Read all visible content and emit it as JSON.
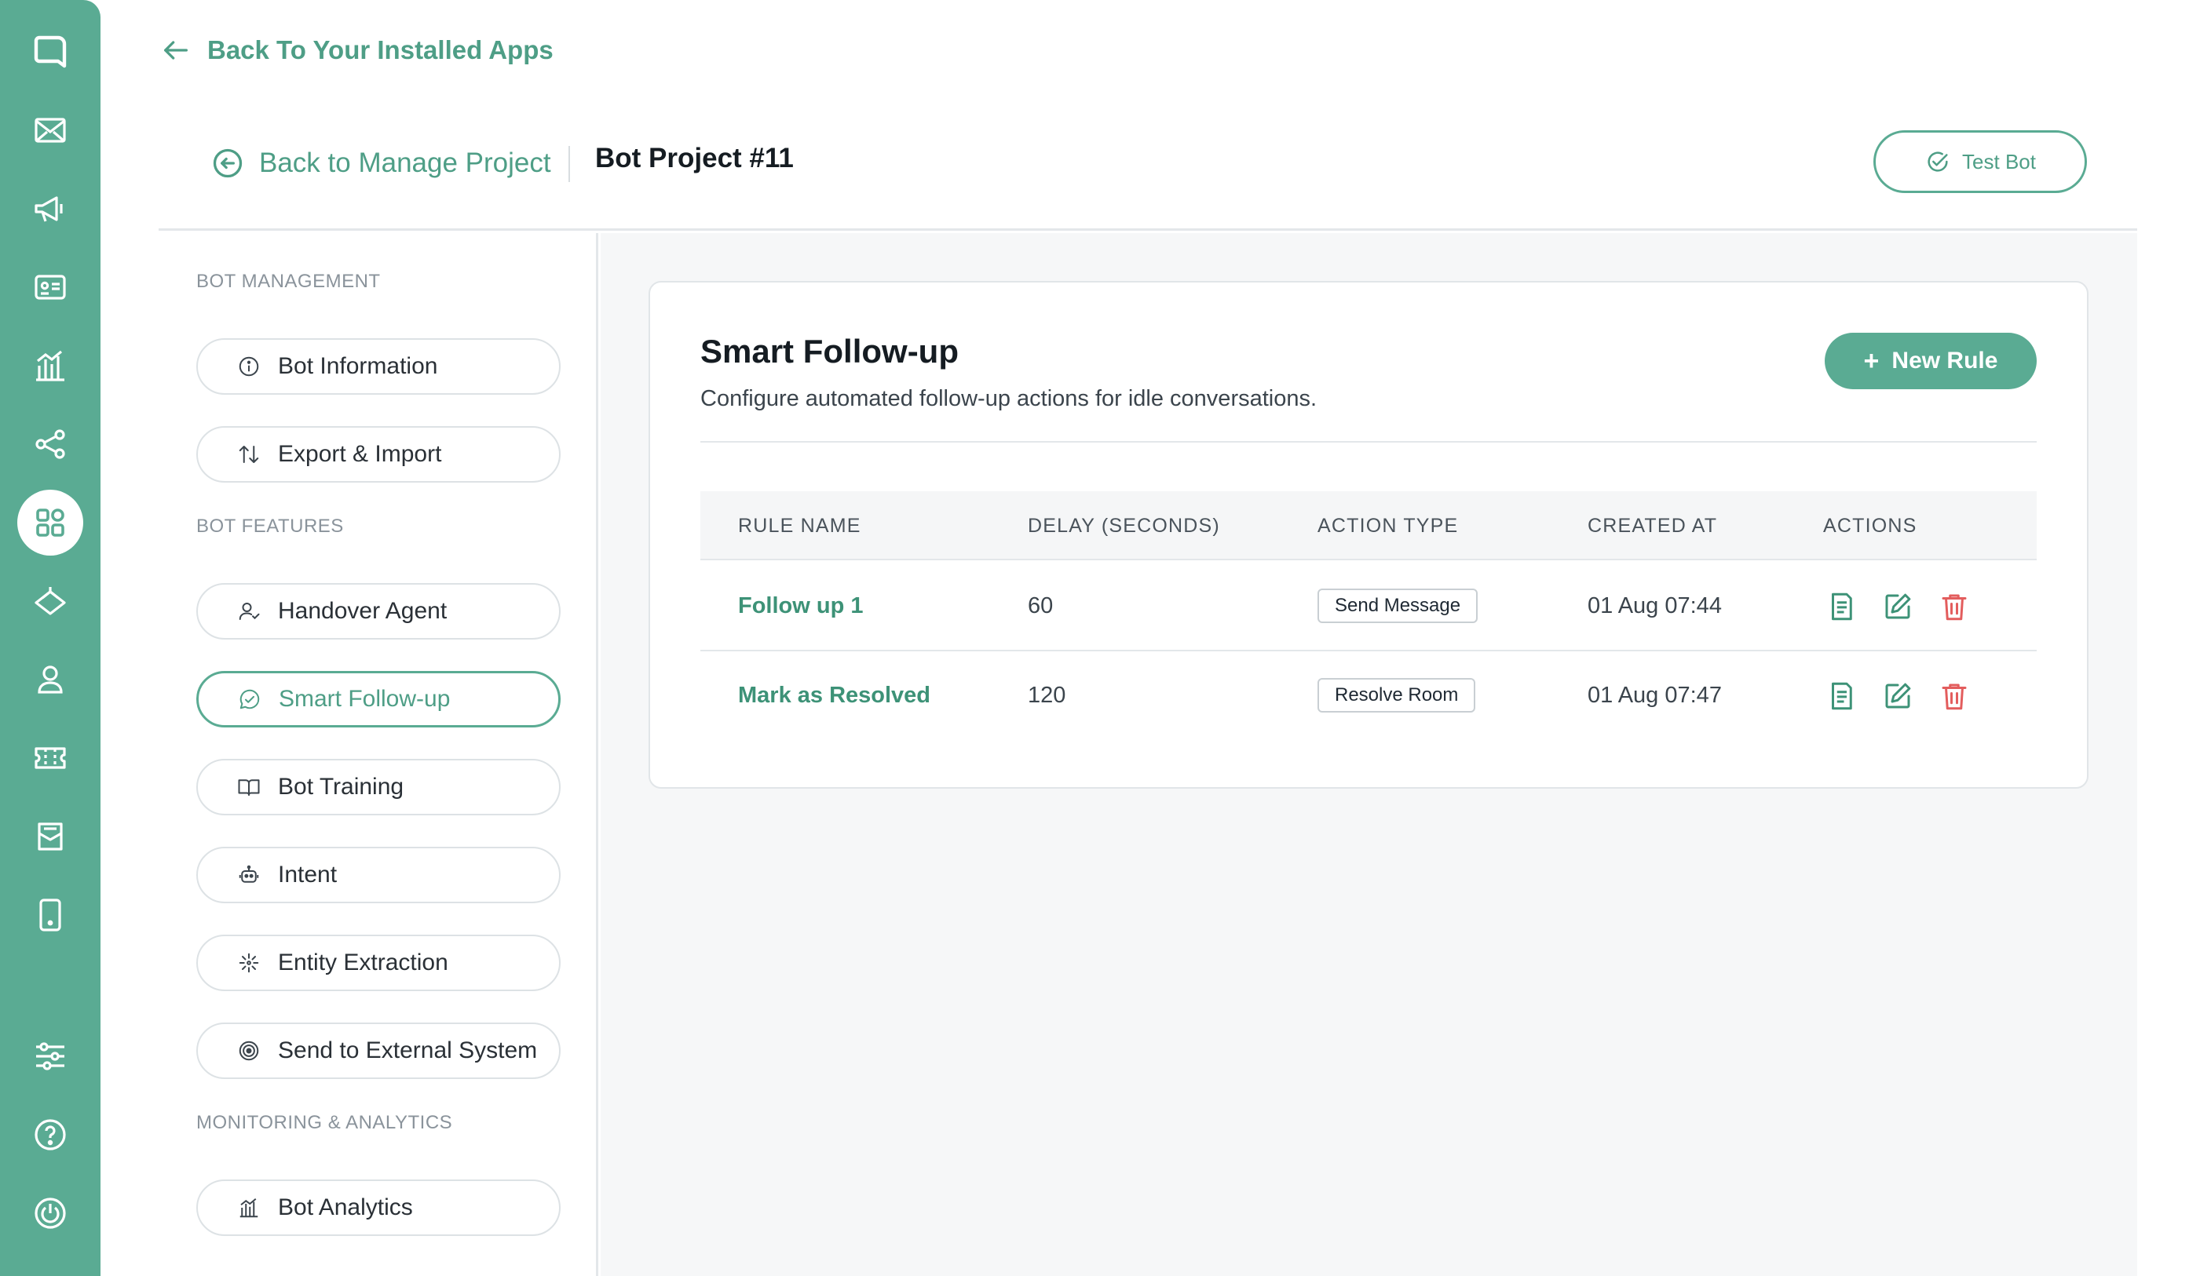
{
  "nav": {
    "top_back": "Back To Your Installed Apps",
    "rail_icons": [
      "chat-logo-icon",
      "mail-icon",
      "megaphone-icon",
      "contact-card-icon",
      "analytics-icon",
      "share-nodes-icon",
      "apps-grid-icon",
      "broadcast-icon",
      "user-icon",
      "ticket-icon",
      "inbox-icon",
      "mobile-icon",
      "settings-sliders-icon",
      "help-icon",
      "power-icon"
    ]
  },
  "header": {
    "back_label": "Back to Manage Project",
    "project_title": "Bot Project #11",
    "test_bot_label": "Test Bot"
  },
  "menu": {
    "section_management": "BOT MANAGEMENT",
    "section_features": "BOT FEATURES",
    "section_monitoring": "MONITORING & ANALYTICS",
    "items": [
      {
        "label": "Bot Information",
        "icon": "info-icon"
      },
      {
        "label": "Export & Import",
        "icon": "arrows-updown-icon"
      },
      {
        "label": "Handover Agent",
        "icon": "user-handover-icon"
      },
      {
        "label": "Smart Follow-up",
        "icon": "chat-followup-icon",
        "active": true
      },
      {
        "label": "Bot Training",
        "icon": "book-icon"
      },
      {
        "label": "Intent",
        "icon": "robot-icon"
      },
      {
        "label": "Entity Extraction",
        "icon": "sparkle-icon"
      },
      {
        "label": "Send to External System",
        "icon": "target-icon"
      },
      {
        "label": "Bot Analytics",
        "icon": "analytics-icon"
      }
    ]
  },
  "card": {
    "title": "Smart Follow-up",
    "subtitle": "Configure automated follow-up actions for idle conversations.",
    "new_rule_label": "New Rule",
    "columns": [
      "RULE NAME",
      "DELAY (SECONDS)",
      "ACTION TYPE",
      "CREATED AT",
      "ACTIONS"
    ],
    "rows": [
      {
        "name": "Follow up 1",
        "delay": "60",
        "action_type": "Send Message",
        "created_at": "01 Aug 07:44"
      },
      {
        "name": "Mark as Resolved",
        "delay": "120",
        "action_type": "Resolve Room",
        "created_at": "01 Aug 07:47"
      }
    ]
  },
  "colors": {
    "brand": "#5aab93",
    "brand_text": "#4e9e86",
    "danger": "#e35d5d"
  }
}
